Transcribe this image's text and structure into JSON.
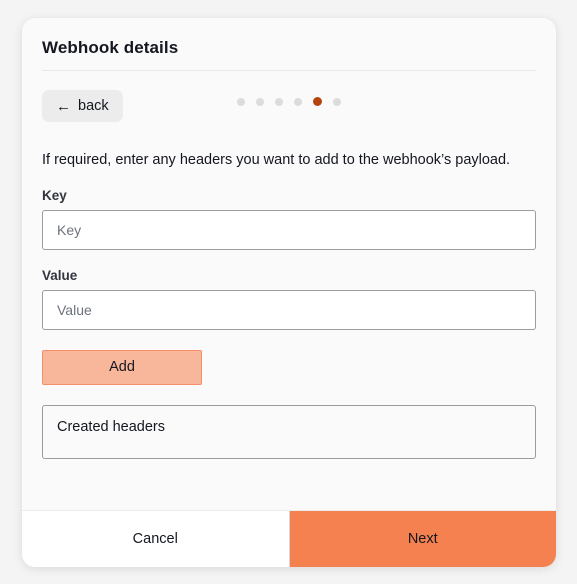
{
  "card": {
    "title": "Webhook details",
    "back_button": {
      "label": "back",
      "arrow": "←"
    },
    "steps": {
      "total": 6,
      "active_index": 5,
      "active_color": "#b5450f",
      "inactive_color": "#dcdcdc"
    },
    "description": "If required, enter any headers you want to add to the webhook’s payload.",
    "fields": [
      {
        "label": "Key",
        "placeholder": "Key",
        "value": ""
      },
      {
        "label": "Value",
        "placeholder": "Value",
        "value": ""
      }
    ],
    "add_button": {
      "label": "Add",
      "background": "#f8b79b",
      "border": "#f3906a"
    },
    "created_headers": {
      "label": "Created headers",
      "items": []
    },
    "footer": {
      "cancel_label": "Cancel",
      "next_label": "Next",
      "next_color": "#f4814f"
    }
  }
}
